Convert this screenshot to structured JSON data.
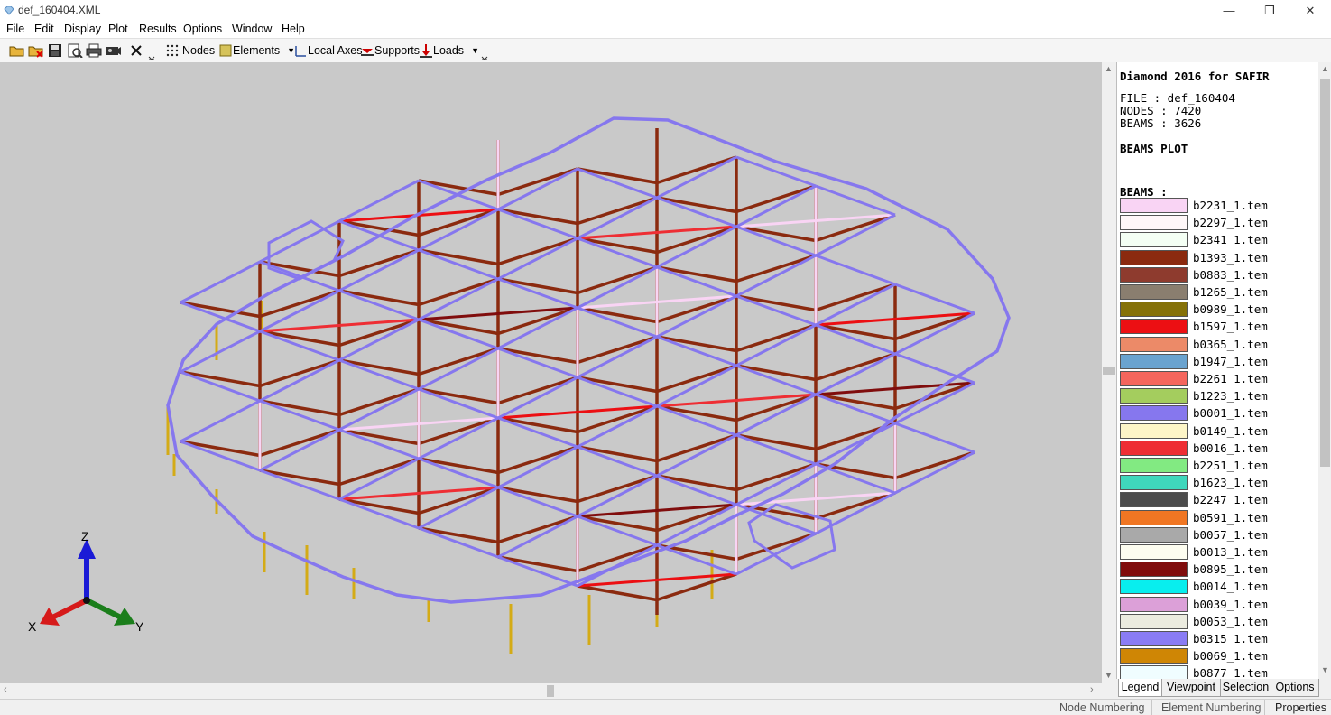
{
  "window": {
    "title": "def_160404.XML"
  },
  "menu": [
    "File",
    "Edit",
    "Display",
    "Plot",
    "Results",
    "Options",
    "Window",
    "Help"
  ],
  "toolbar": {
    "nodes": "Nodes",
    "elements": "Elements",
    "local_axes": "Local Axes",
    "supports": "Supports",
    "loads": "Loads"
  },
  "axes": {
    "z": "Z",
    "x": "X",
    "y": "Y"
  },
  "panel": {
    "heading": "Diamond 2016 for SAFIR",
    "file": "FILE : def_160404",
    "nodes": "NODES : 7420",
    "beams_count": "BEAMS : 3626",
    "plot_title": "BEAMS PLOT",
    "beams_label": "BEAMS :",
    "legend": [
      {
        "name": "b2231_1.tem",
        "color": "#f9d4f4"
      },
      {
        "name": "b2297_1.tem",
        "color": "#fff7f8"
      },
      {
        "name": "b2341_1.tem",
        "color": "#f4fff4"
      },
      {
        "name": "b1393_1.tem",
        "color": "#8b2a0f"
      },
      {
        "name": "b0883_1.tem",
        "color": "#8e3b2e"
      },
      {
        "name": "b1265_1.tem",
        "color": "#8a7e6f"
      },
      {
        "name": "b0989_1.tem",
        "color": "#857108"
      },
      {
        "name": "b1597_1.tem",
        "color": "#ec0f13"
      },
      {
        "name": "b0365_1.tem",
        "color": "#ec8a68"
      },
      {
        "name": "b1947_1.tem",
        "color": "#6aa3cf"
      },
      {
        "name": "b2261_1.tem",
        "color": "#f4665d"
      },
      {
        "name": "b1223_1.tem",
        "color": "#a4cd5e"
      },
      {
        "name": "b0001_1.tem",
        "color": "#8677ee"
      },
      {
        "name": "b0149_1.tem",
        "color": "#fdf5c7"
      },
      {
        "name": "b0016_1.tem",
        "color": "#ee2e34"
      },
      {
        "name": "b2251_1.tem",
        "color": "#82ea82"
      },
      {
        "name": "b1623_1.tem",
        "color": "#3fd7bc"
      },
      {
        "name": "b2247_1.tem",
        "color": "#4c4c4c"
      },
      {
        "name": "b0591_1.tem",
        "color": "#f07623"
      },
      {
        "name": "b0057_1.tem",
        "color": "#a9a9a9"
      },
      {
        "name": "b0013_1.tem",
        "color": "#fdfdf0"
      },
      {
        "name": "b0895_1.tem",
        "color": "#800d0d"
      },
      {
        "name": "b0014_1.tem",
        "color": "#08eeee"
      },
      {
        "name": "b0039_1.tem",
        "color": "#dca0d8"
      },
      {
        "name": "b0053_1.tem",
        "color": "#ebebdf"
      },
      {
        "name": "b0315_1.tem",
        "color": "#8a7cf4"
      },
      {
        "name": "b0069_1.tem",
        "color": "#cf8605"
      },
      {
        "name": "b0877_1.tem",
        "color": "#f0fdff"
      }
    ]
  },
  "tabs": [
    "Legend",
    "Viewpoint",
    "Selection",
    "Options"
  ],
  "status": [
    "Node Numbering",
    "Element Numbering",
    "Properties"
  ]
}
